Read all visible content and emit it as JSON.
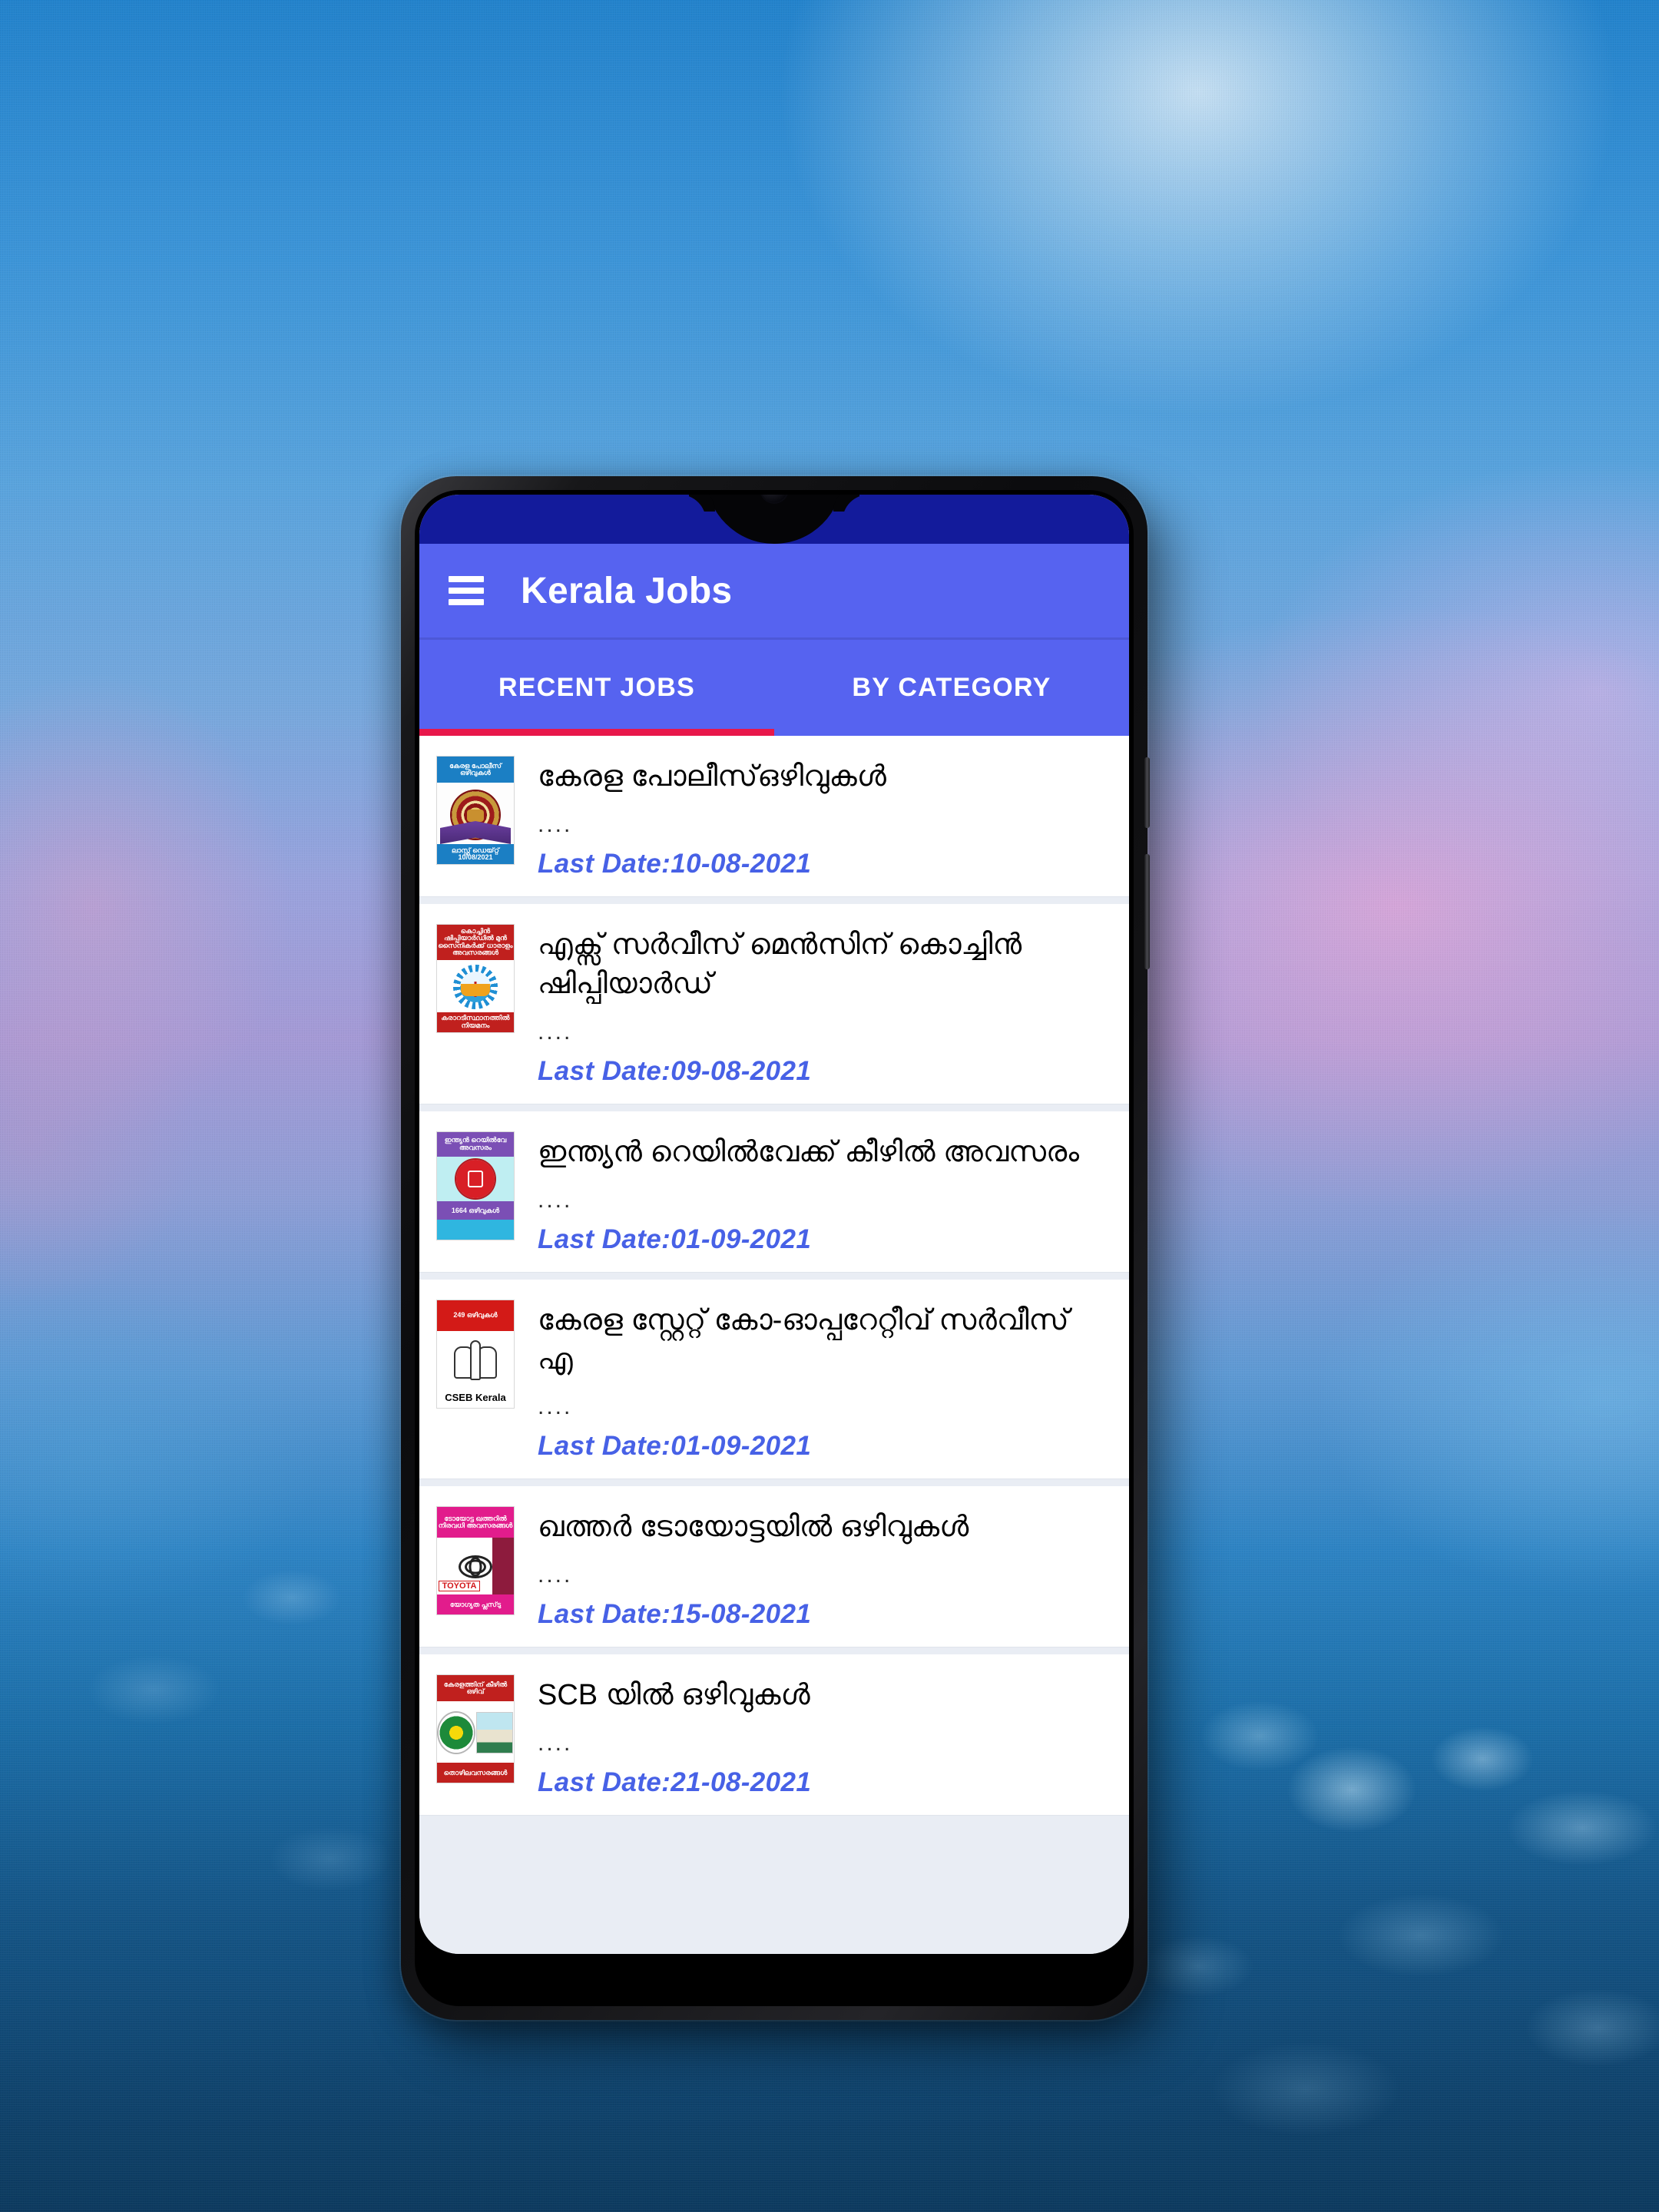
{
  "wallpaper": {
    "description": "blurred blue bokeh water-droplet gradient wallpaper",
    "colors": {
      "top_left": "#2383cc",
      "top_right_glow": "#ffffff",
      "mid_pink": "#e8a8d8",
      "bottom": "#0d3a5f"
    }
  },
  "device": {
    "name": "android-phone-mockup",
    "notch": "waterdrop-notch",
    "camera": "front-camera"
  },
  "app": {
    "status_bar_color": "#131b9b",
    "app_bar_color": "#5663f0",
    "accent_color": "#e8174a",
    "date_color": "#4761e6",
    "menu_icon": "hamburger-menu-icon",
    "title": "Kerala Jobs"
  },
  "tabs": {
    "active_index": 0,
    "items": [
      {
        "label": "RECENT JOBS"
      },
      {
        "label": "BY CATEGORY"
      }
    ]
  },
  "list": {
    "dots": "....",
    "items": [
      {
        "title": "കേരള പോലീസ്ഒഴിവുകൾ",
        "snippet": "....",
        "date": "Last Date:10-08-2021",
        "thumb_name": "kerala-police-emblem-thumbnail",
        "thumb_caption": "കേരള പോലീസ് ഒഴിവുകൾ",
        "thumb_footer": "ലാസ്റ്റ് ഡെയ്റ്റ് 10/08/2021"
      },
      {
        "title": "എക്സ് സർവീസ് മെൻസിന് കൊച്ചിൻ ഷിപ്പിയാർഡ്",
        "snippet": "....",
        "date": "Last Date:09-08-2021",
        "thumb_name": "cochin-shipyard-logo-thumbnail",
        "thumb_caption": "കൊച്ചിൻ ഷിപ്പിയാർഡിൽ മുൻ സൈനികർക്ക് ധാരാളം അവസരങ്ങൾ",
        "thumb_footer": "കരാറടിസ്ഥാനത്തിൽ നിയമനം"
      },
      {
        "title": "ഇന്ത്യൻ റെയിൽവേക്ക് കീഴിൽ അവസരം",
        "snippet": "....",
        "date": "Last Date:01-09-2021",
        "thumb_name": "indian-railway-emblem-thumbnail",
        "thumb_caption": "ഇന്ത്യൻ റെയിൽവേ അവസരം",
        "thumb_footer": "1664 ഒഴിവുകൾ"
      },
      {
        "title": "കേരള സ്റ്റേറ്റ് കോ-ഓപ്പറേറ്റീവ് സർവീസ് എ",
        "snippet": "....",
        "date": "Last Date:01-09-2021",
        "thumb_name": "cseb-kerala-emblem-thumbnail",
        "thumb_caption": "249 ഒഴിവുകൾ",
        "thumb_footer": "CSEB Kerala"
      },
      {
        "title": "ഖത്തർ ടോയോട്ടയിൽ ഒഴിവുകൾ",
        "snippet": "....",
        "date": "Last Date:15-08-2021",
        "thumb_name": "toyota-qatar-logo-thumbnail",
        "thumb_caption": "ടോയോട്ട ഖത്തറിൽ നിരവധി അവസരങ്ങൾ",
        "thumb_footer": "യോഗ്യത പ്ലസ്‌ടു",
        "thumb_wordmark": "TOYOTA"
      },
      {
        "title": "SCB യിൽ ഒഴിവുകൾ",
        "snippet": "....",
        "date": "Last Date:21-08-2021",
        "thumb_name": "scb-bank-emblem-thumbnail",
        "thumb_caption": "കേരളത്തിന് കീഴിൽ ഒഴിവ്",
        "thumb_footer": "തൊഴിലവസരങ്ങൾ"
      }
    ]
  }
}
